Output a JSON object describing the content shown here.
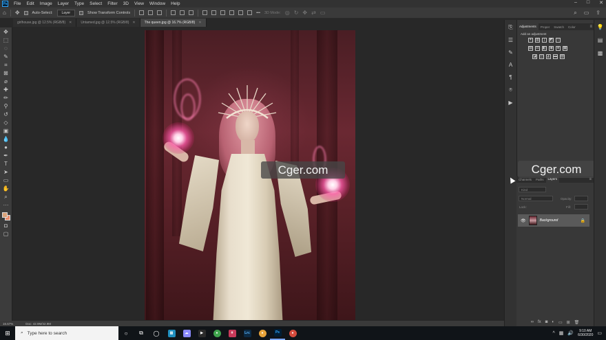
{
  "app": {
    "logo": "Ps",
    "menu": [
      "File",
      "Edit",
      "Image",
      "Layer",
      "Type",
      "Select",
      "Filter",
      "3D",
      "View",
      "Window",
      "Help"
    ],
    "window_controls": [
      "–",
      "□",
      "✕"
    ]
  },
  "options_bar": {
    "auto_select_label": "Auto-Select:",
    "auto_select_value": "Layer",
    "transform_controls_label": "Show Transform Controls",
    "mode_3d_label": "3D Mode:",
    "more_label": "•••"
  },
  "tabs": [
    {
      "label": "girlhouse.jpg @ 12.5% (RGB/8)",
      "active": false
    },
    {
      "label": "Untamed.jpg @ 12.5% (RGB/8)",
      "active": false
    },
    {
      "label": "The queen.jpg @ 16.7% (RGB/8)",
      "active": true
    }
  ],
  "tools": [
    "move-tool",
    "artboard-tool",
    "lasso-tool",
    "quick-select-tool",
    "crop-tool",
    "frame-tool",
    "eyedropper-tool",
    "healing-tool",
    "brush-tool",
    "stamp-tool",
    "history-brush-tool",
    "eraser-tool",
    "gradient-tool",
    "blur-tool",
    "dodge-tool",
    "pen-tool",
    "type-tool",
    "path-select-tool",
    "rectangle-tool",
    "hand-tool",
    "zoom-tool",
    "more-tools"
  ],
  "colors": {
    "foreground": "#d9a27a",
    "background": "#e88a6a",
    "accent": "#31a8ff",
    "watermark_bg": "#464646"
  },
  "watermarks": [
    "Cger.com",
    "Cger.com"
  ],
  "status_bar": {
    "zoom": "16.67%",
    "doc_info": "Doc: 42.9M/42.9M"
  },
  "adjustments_panel": {
    "tabs": [
      "Adjustments",
      "Proper",
      "Swatch",
      "Color"
    ],
    "subtitle": "Add an adjustment"
  },
  "layers_panel": {
    "tabs": [
      "Channels",
      "Paths",
      "Layers"
    ],
    "kind_filter": "Kind",
    "blend_mode": "Normal",
    "opacity_label": "Opacity:",
    "lock_label": "Lock:",
    "fill_label": "Fill:",
    "layers": [
      {
        "name": "Background",
        "visible": true,
        "locked": true
      }
    ]
  },
  "taskbar": {
    "search_placeholder": "Type here to search",
    "apps": [
      "task-view",
      "file-explorer",
      "store",
      "photos",
      "chrome",
      "slack",
      "lrc",
      "chrome-alt",
      "photoshop",
      "chrome-profile"
    ],
    "time": "9:10 AM",
    "date": "6/30/2020"
  }
}
